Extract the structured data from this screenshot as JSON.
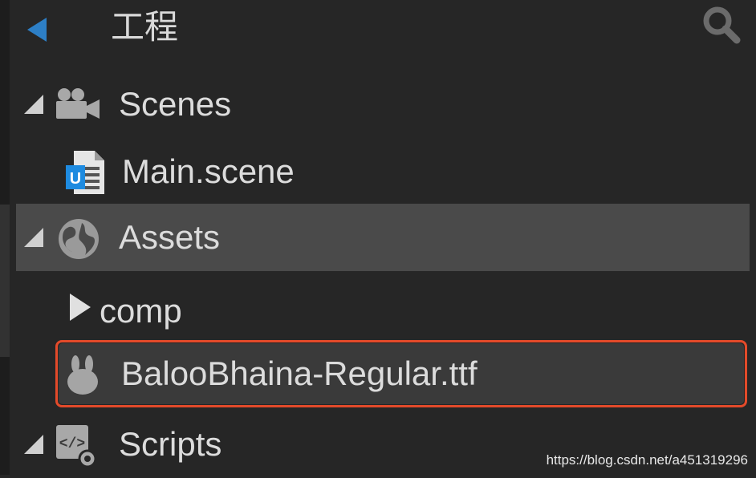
{
  "panel": {
    "title": "工程"
  },
  "tree": {
    "scenes": {
      "label": "Scenes",
      "icon": "camera-icon"
    },
    "main_scene": {
      "label": "Main.scene",
      "icon": "scene-file-icon"
    },
    "assets": {
      "label": "Assets",
      "icon": "globe-icon"
    },
    "comp": {
      "label": "comp",
      "icon": "folder-arrow-icon"
    },
    "font_file": {
      "label": "BalooBhaina-Regular.ttf",
      "icon": "font-bunny-icon"
    },
    "scripts": {
      "label": "Scripts",
      "icon": "script-gear-icon"
    }
  },
  "watermark": "https://blog.csdn.net/a451319296",
  "colors": {
    "background": "#262626",
    "selected_row": "#4a4a4a",
    "highlight_border": "#e34a2a",
    "back_arrow": "#2d7fc6"
  }
}
